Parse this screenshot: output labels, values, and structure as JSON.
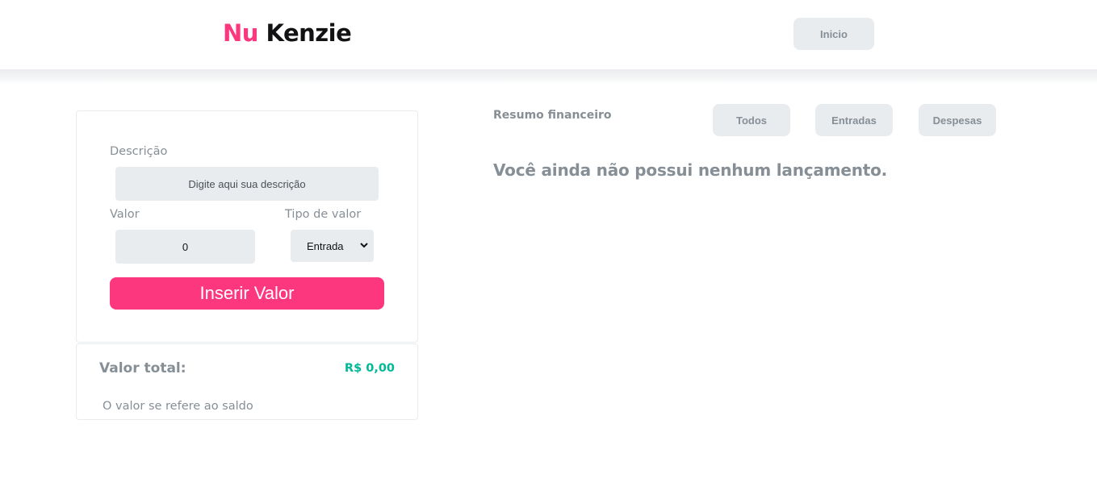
{
  "header": {
    "logo_part1": "Nu",
    "logo_part2": "Kenzie",
    "inicio_label": "Inicio"
  },
  "form": {
    "description_label": "Descrição",
    "description_placeholder": "Digite aqui sua descrição",
    "value_label": "Valor",
    "value_input": "0",
    "type_label": "Tipo de valor",
    "type_selected": "Entrada",
    "submit_label": "Inserir Valor"
  },
  "total": {
    "label": "Valor total:",
    "value": "R$ 0,00",
    "note": "O valor se refere ao saldo"
  },
  "summary": {
    "title": "Resumo financeiro",
    "filters": [
      "Todos",
      "Entradas",
      "Despesas"
    ],
    "empty_message": "Você ainda não possui nenhum lançamento."
  },
  "colors": {
    "brand_pink": "#fd377e",
    "positive_green": "#03b898",
    "neutral_gray": "#868e96",
    "button_bg": "#e9ecef"
  },
  "icons": {
    "select_arrow": "chevron-down-icon"
  }
}
